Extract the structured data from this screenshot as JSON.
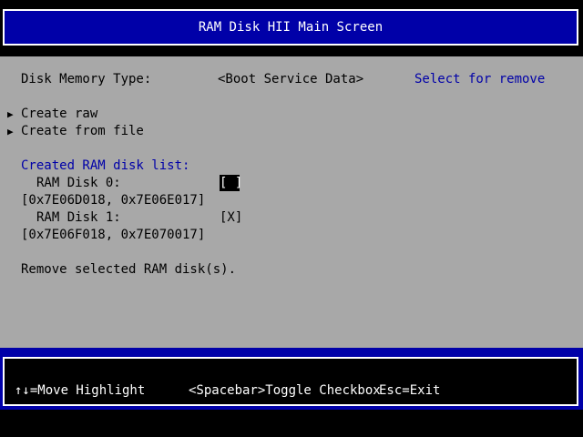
{
  "header": {
    "title": "RAM Disk HII Main Screen"
  },
  "main": {
    "memory_type": {
      "label": "Disk Memory Type:",
      "value": "<Boot Service Data>",
      "help": "Select for remove"
    },
    "actions": [
      {
        "arrow": "▶",
        "label": "Create raw"
      },
      {
        "arrow": "▶",
        "label": "Create from file"
      }
    ],
    "list_title": "Created RAM disk list:",
    "disks": [
      {
        "name": "RAM Disk 0:",
        "range": "[0x7E06D018, 0x7E06E017]",
        "checkbox": "[ ]"
      },
      {
        "name": "RAM Disk 1:",
        "range": "[0x7E06F018, 0x7E070017]",
        "checkbox": "[X]"
      }
    ],
    "remove_label": "Remove selected RAM disk(s)."
  },
  "footer": {
    "move_help": "↑↓=Move Highlight",
    "toggle_help": "<Spacebar>Toggle Checkbox",
    "exit_help": "Esc=Exit"
  },
  "colors": {
    "background": "#a8a8a8",
    "accent_blue": "#0000a8",
    "text": "#000000",
    "highlight": "#ffffff"
  }
}
